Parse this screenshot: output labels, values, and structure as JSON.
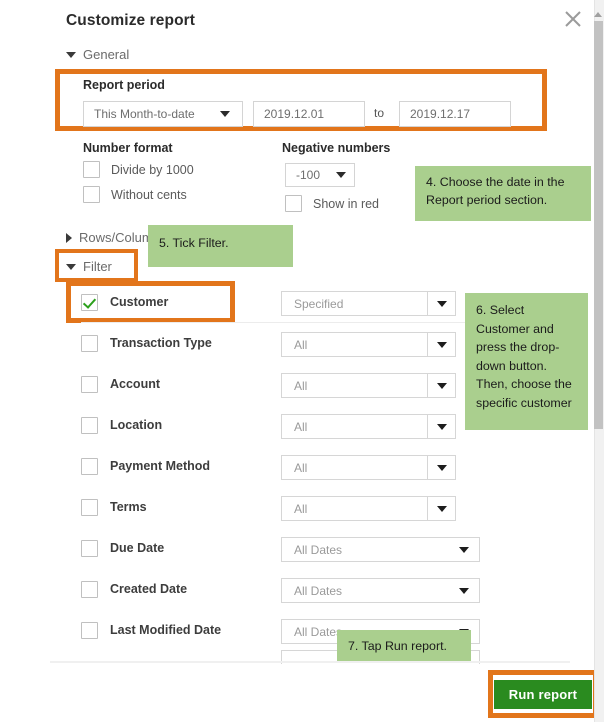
{
  "dialog": {
    "title": "Customize report",
    "close_icon": "close-icon"
  },
  "sections": {
    "general": {
      "label": "General",
      "expanded": true
    },
    "rows_columns": {
      "label": "Rows/Columns",
      "expanded": false
    },
    "filter": {
      "label": "Filter",
      "expanded": true
    }
  },
  "report_period": {
    "label": "Report period",
    "preset": "This Month-to-date",
    "from": "2019.12.01",
    "to_label": "to",
    "until": "2019.12.17"
  },
  "number_format": {
    "title": "Number format",
    "options": [
      {
        "label": "Divide by 1000",
        "checked": false
      },
      {
        "label": "Without cents",
        "checked": false
      }
    ]
  },
  "negative_numbers": {
    "title": "Negative numbers",
    "value": "-100",
    "show_in_red": {
      "label": "Show in red",
      "checked": false
    }
  },
  "filters": [
    {
      "label": "Customer",
      "checked": true,
      "value": "Specified",
      "style": "split"
    },
    {
      "label": "Transaction Type",
      "checked": false,
      "value": "All",
      "style": "split"
    },
    {
      "label": "Account",
      "checked": false,
      "value": "All",
      "style": "split"
    },
    {
      "label": "Location",
      "checked": false,
      "value": "All",
      "style": "split"
    },
    {
      "label": "Payment Method",
      "checked": false,
      "value": "All",
      "style": "split"
    },
    {
      "label": "Terms",
      "checked": false,
      "value": "All",
      "style": "split"
    },
    {
      "label": "Due Date",
      "checked": false,
      "value": "All Dates",
      "style": "wide"
    },
    {
      "label": "Created Date",
      "checked": false,
      "value": "All Dates",
      "style": "wide"
    },
    {
      "label": "Last Modified Date",
      "checked": false,
      "value": "All Dates",
      "style": "wide"
    }
  ],
  "footer": {
    "run_report": "Run report"
  },
  "callouts": [
    {
      "id": "co4",
      "text": "4. Choose the date in the Report period section."
    },
    {
      "id": "co5",
      "text": "5. Tick Filter."
    },
    {
      "id": "co6",
      "text": "6. Select Customer and press the drop-down button. Then, choose the specific customer"
    },
    {
      "id": "co7",
      "text": "7. Tap Run report."
    }
  ],
  "colors": {
    "highlight_orange": "#E2751B",
    "callout_green": "#AACF8E",
    "button_green": "#2A8B1F",
    "check_green": "#2CA01C"
  },
  "scrollbar": {
    "up_icon": "chevron-up-icon"
  }
}
